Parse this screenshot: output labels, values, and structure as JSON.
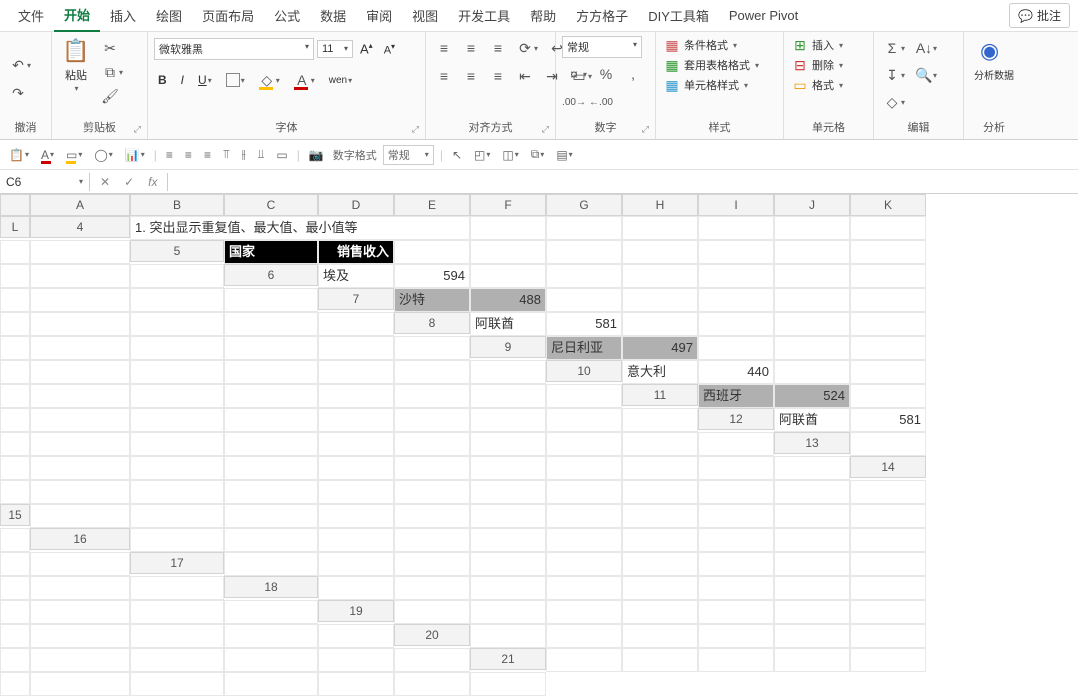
{
  "menu": {
    "tabs": [
      "文件",
      "开始",
      "插入",
      "绘图",
      "页面布局",
      "公式",
      "数据",
      "审阅",
      "视图",
      "开发工具",
      "帮助",
      "方方格子",
      "DIY工具箱",
      "Power Pivot"
    ],
    "active_index": 1,
    "annotate": "批注"
  },
  "ribbon": {
    "undo": {
      "label": "撤消"
    },
    "clipboard": {
      "paste": "粘贴",
      "label": "剪贴板"
    },
    "font": {
      "name": "微软雅黑",
      "size": "11",
      "label": "字体",
      "bold": "B",
      "italic": "I",
      "underline": "U",
      "wen": "wen"
    },
    "alignment": {
      "label": "对齐方式"
    },
    "number": {
      "format": "常规",
      "label": "数字"
    },
    "styles": {
      "conditional": "条件格式",
      "table_format": "套用表格格式",
      "cell_styles": "单元格样式",
      "label": "样式"
    },
    "cells": {
      "insert": "插入",
      "delete": "删除",
      "format": "格式",
      "label": "单元格"
    },
    "editing": {
      "label": "编辑"
    },
    "analysis": {
      "btn": "分析数据",
      "label": "分析"
    }
  },
  "secondary": {
    "numfmt_label": "数字格式",
    "numfmt_value": "常规"
  },
  "namebox": "C6",
  "columns": [
    "A",
    "B",
    "C",
    "D",
    "E",
    "F",
    "G",
    "H",
    "I",
    "J",
    "K",
    "L"
  ],
  "rows_start": 4,
  "rows_end": 21,
  "cells": {
    "title": "1. 突出显示重复值、最大值、最小值等",
    "header": [
      "国家",
      "销售收入"
    ],
    "data": [
      {
        "c": "埃及",
        "v": "594",
        "shade": false
      },
      {
        "c": "沙特",
        "v": "488",
        "shade": true
      },
      {
        "c": "阿联酋",
        "v": "581",
        "shade": false
      },
      {
        "c": "尼日利亚",
        "v": "497",
        "shade": true
      },
      {
        "c": "意大利",
        "v": "440",
        "shade": false
      },
      {
        "c": "西班牙",
        "v": "524",
        "shade": true
      },
      {
        "c": "阿联酋",
        "v": "581",
        "shade": false
      }
    ]
  }
}
